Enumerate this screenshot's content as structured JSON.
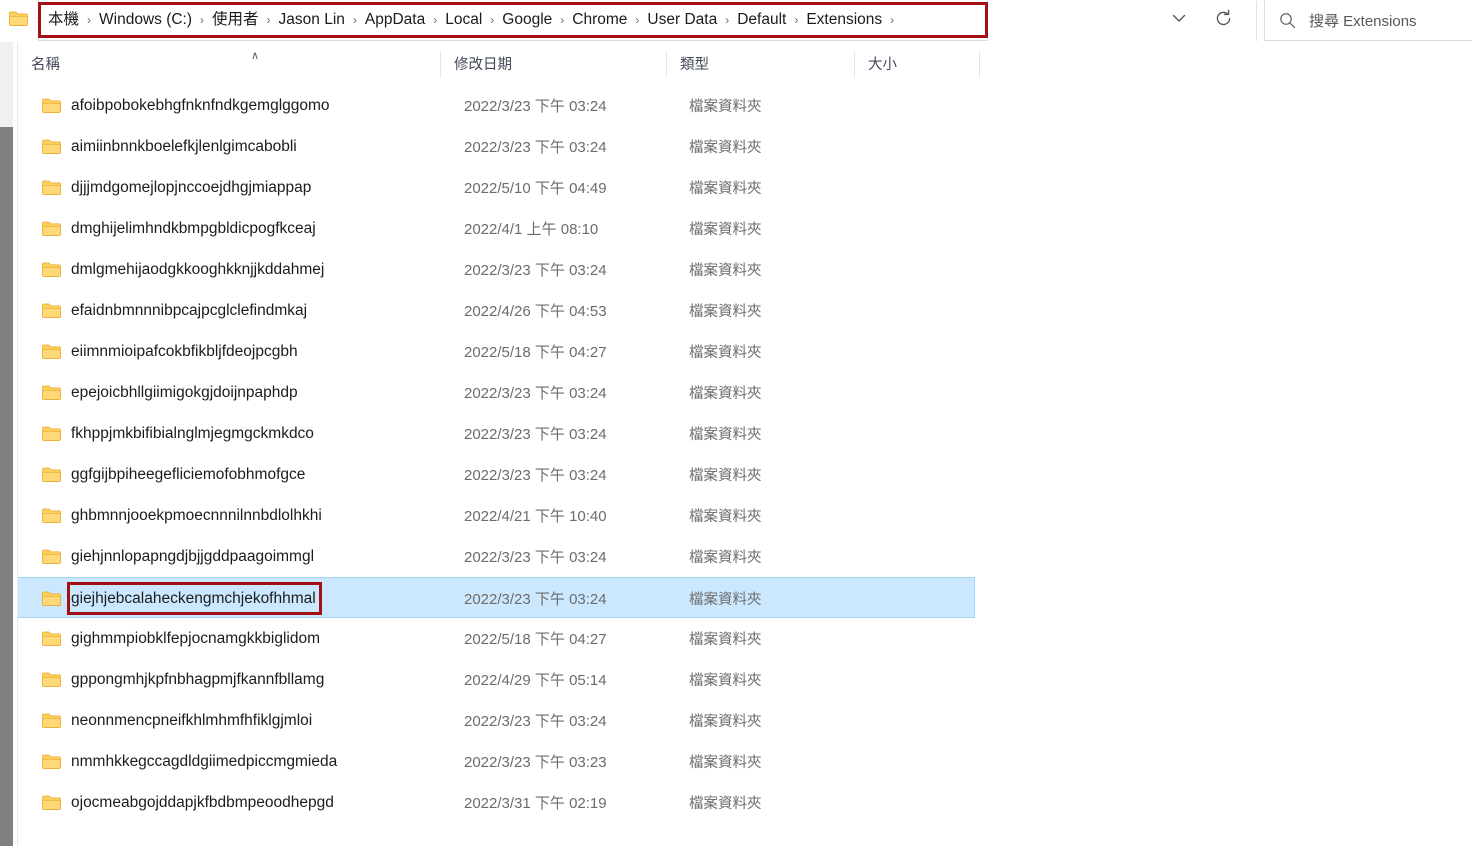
{
  "window": {
    "type": "file-explorer",
    "accent_selection": "#cce8ff",
    "annotation_color": "#a30f14"
  },
  "addressbar": {
    "leading_icon": "folder-icon",
    "leading_separator": "›",
    "crumbs": [
      "本機",
      "Windows (C:)",
      "使用者",
      "Jason Lin",
      "AppData",
      "Local",
      "Google",
      "Chrome",
      "User Data",
      "Default",
      "Extensions"
    ],
    "separator": "›",
    "dropdown_icon": "chevron-down-icon",
    "refresh_icon": "refresh-icon",
    "annotated": true
  },
  "search": {
    "icon": "search-icon",
    "placeholder": "搜尋 Extensions",
    "value": ""
  },
  "columns": {
    "name": "名稱",
    "date_modified": "修改日期",
    "type": "類型",
    "size": "大小",
    "sort_indicator": "∧",
    "sort_column": "名稱",
    "sort_direction": "ascending"
  },
  "files": [
    {
      "icon": "folder-icon",
      "name": "afoibpobokebhgfnknfndkgemglggomo",
      "date": "2022/3/23 下午 03:24",
      "type": "檔案資料夾",
      "size": "",
      "selected": false,
      "annotated": false
    },
    {
      "icon": "folder-icon",
      "name": "aimiinbnnkboelefkjlenlgimcabobli",
      "date": "2022/3/23 下午 03:24",
      "type": "檔案資料夾",
      "size": "",
      "selected": false,
      "annotated": false
    },
    {
      "icon": "folder-icon",
      "name": "djjjmdgomejlopjnccoejdhgjmiappap",
      "date": "2022/5/10 下午 04:49",
      "type": "檔案資料夾",
      "size": "",
      "selected": false,
      "annotated": false
    },
    {
      "icon": "folder-icon",
      "name": "dmghijelimhndkbmpgbldicpogfkceaj",
      "date": "2022/4/1 上午 08:10",
      "type": "檔案資料夾",
      "size": "",
      "selected": false,
      "annotated": false
    },
    {
      "icon": "folder-icon",
      "name": "dmlgmehijaodgkkooghkknjjkddahmej",
      "date": "2022/3/23 下午 03:24",
      "type": "檔案資料夾",
      "size": "",
      "selected": false,
      "annotated": false
    },
    {
      "icon": "folder-icon",
      "name": "efaidnbmnnnibpcajpcglclefindmkaj",
      "date": "2022/4/26 下午 04:53",
      "type": "檔案資料夾",
      "size": "",
      "selected": false,
      "annotated": false
    },
    {
      "icon": "folder-icon",
      "name": "eiimnmioipafcokbfikbljfdeojpcgbh",
      "date": "2022/5/18 下午 04:27",
      "type": "檔案資料夾",
      "size": "",
      "selected": false,
      "annotated": false
    },
    {
      "icon": "folder-icon",
      "name": "epejoicbhllgiimigokgjdoijnpaphdp",
      "date": "2022/3/23 下午 03:24",
      "type": "檔案資料夾",
      "size": "",
      "selected": false,
      "annotated": false
    },
    {
      "icon": "folder-icon",
      "name": "fkhppjmkbifibialnglmjegmgckmkdco",
      "date": "2022/3/23 下午 03:24",
      "type": "檔案資料夾",
      "size": "",
      "selected": false,
      "annotated": false
    },
    {
      "icon": "folder-icon",
      "name": "ggfgijbpiheegefliciemofobhmofgce",
      "date": "2022/3/23 下午 03:24",
      "type": "檔案資料夾",
      "size": "",
      "selected": false,
      "annotated": false
    },
    {
      "icon": "folder-icon",
      "name": "ghbmnnjooekpmoecnnnilnnbdlolhkhi",
      "date": "2022/4/21 下午 10:40",
      "type": "檔案資料夾",
      "size": "",
      "selected": false,
      "annotated": false
    },
    {
      "icon": "folder-icon",
      "name": "giehjnnlopapngdjbjjgddpaagoimmgl",
      "date": "2022/3/23 下午 03:24",
      "type": "檔案資料夾",
      "size": "",
      "selected": false,
      "annotated": false
    },
    {
      "icon": "folder-icon",
      "name": "giejhjebcalaheckengmchjekofhhmal",
      "date": "2022/3/23 下午 03:24",
      "type": "檔案資料夾",
      "size": "",
      "selected": true,
      "annotated": true
    },
    {
      "icon": "folder-icon",
      "name": "gighmmpiobklfepjocnamgkkbiglidom",
      "date": "2022/5/18 下午 04:27",
      "type": "檔案資料夾",
      "size": "",
      "selected": false,
      "annotated": false
    },
    {
      "icon": "folder-icon",
      "name": "gppongmhjkpfnbhagpmjfkannfbllamg",
      "date": "2022/4/29 下午 05:14",
      "type": "檔案資料夾",
      "size": "",
      "selected": false,
      "annotated": false
    },
    {
      "icon": "folder-icon",
      "name": "neonnmencpneifkhlmhmfhfiklgjmloi",
      "date": "2022/3/23 下午 03:24",
      "type": "檔案資料夾",
      "size": "",
      "selected": false,
      "annotated": false
    },
    {
      "icon": "folder-icon",
      "name": "nmmhkkegccagdldgiimedpiccmgmieda",
      "date": "2022/3/23 下午 03:23",
      "type": "檔案資料夾",
      "size": "",
      "selected": false,
      "annotated": false
    },
    {
      "icon": "folder-icon",
      "name": "ojocmeabgojddapjkfbdbmpeoodhepgd",
      "date": "2022/3/31 下午 02:19",
      "type": "檔案資料夾",
      "size": "",
      "selected": false,
      "annotated": false
    }
  ]
}
